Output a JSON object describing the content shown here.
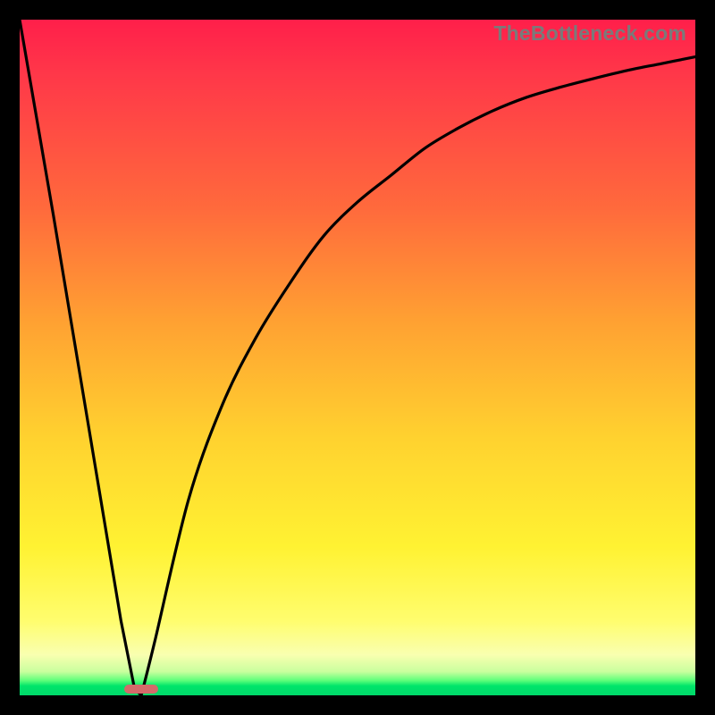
{
  "watermark": "TheBottleneck.com",
  "chart_data": {
    "type": "line",
    "title": "",
    "xlabel": "",
    "ylabel": "",
    "xlim": [
      0,
      100
    ],
    "ylim": [
      0,
      100
    ],
    "grid": false,
    "legend": false,
    "series": [
      {
        "name": "bottleneck-curve",
        "x": [
          0,
          5,
          10,
          15,
          17,
          18,
          20,
          25,
          30,
          35,
          40,
          45,
          50,
          55,
          60,
          65,
          70,
          75,
          80,
          85,
          90,
          95,
          100
        ],
        "values": [
          100,
          71,
          41,
          11,
          1,
          0,
          8,
          29,
          43,
          53,
          61,
          68,
          73,
          77,
          81,
          84,
          86.5,
          88.5,
          90,
          91.3,
          92.5,
          93.5,
          94.5
        ]
      }
    ],
    "marker": {
      "name": "optimal-range",
      "x_start": 15.5,
      "x_end": 20.5,
      "y": 0
    },
    "background_gradient": {
      "orientation": "vertical",
      "stops": [
        {
          "pos": 0.0,
          "color": "#ff1f4a"
        },
        {
          "pos": 0.28,
          "color": "#ff6a3c"
        },
        {
          "pos": 0.62,
          "color": "#ffd22f"
        },
        {
          "pos": 0.89,
          "color": "#fffd6e"
        },
        {
          "pos": 0.97,
          "color": "#5dff7a"
        },
        {
          "pos": 1.0,
          "color": "#00d96a"
        }
      ]
    }
  }
}
